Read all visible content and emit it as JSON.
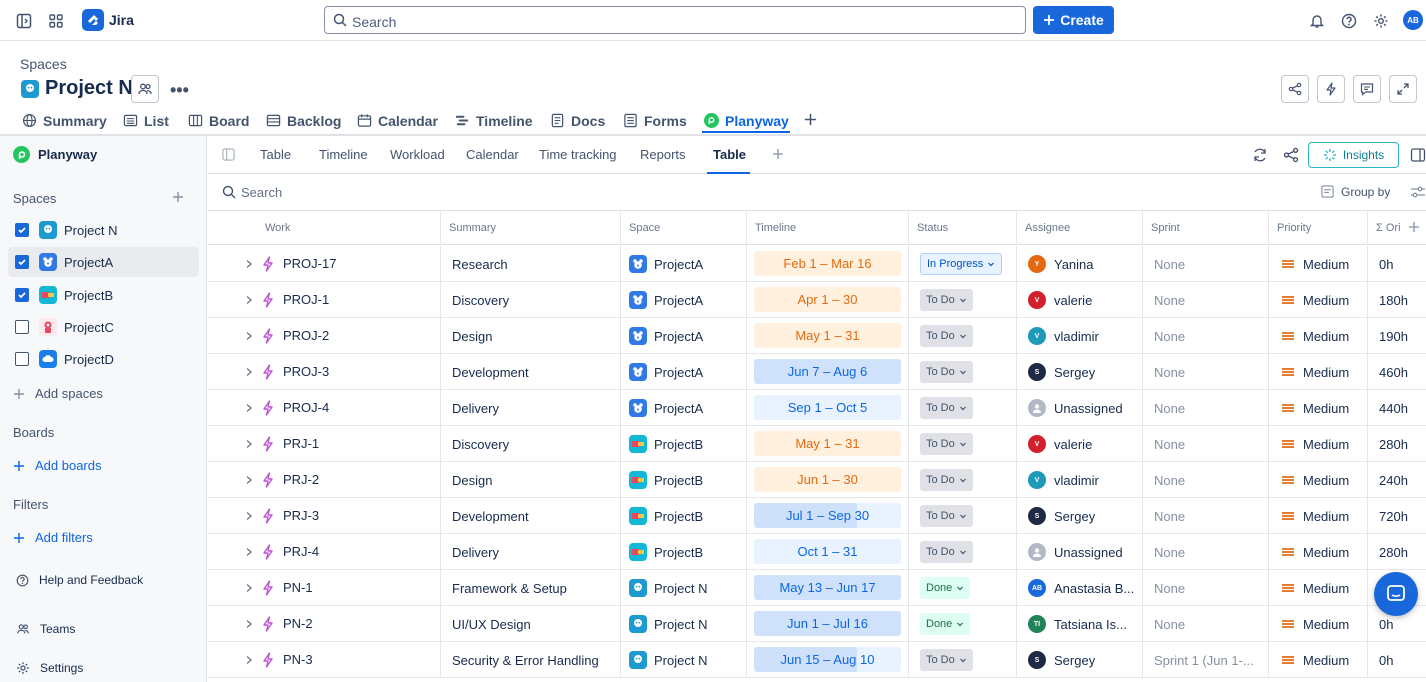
{
  "topbar": {
    "app_name": "Jira",
    "search_placeholder": "Search",
    "create_label": "Create",
    "avatar_initials": "AB"
  },
  "project": {
    "breadcrumb": "Spaces",
    "title": "Project N"
  },
  "project_tabs": [
    {
      "label": "Summary",
      "icon": "globe-icon"
    },
    {
      "label": "List",
      "icon": "list-icon"
    },
    {
      "label": "Board",
      "icon": "board-icon"
    },
    {
      "label": "Backlog",
      "icon": "backlog-icon"
    },
    {
      "label": "Calendar",
      "icon": "calendar-icon"
    },
    {
      "label": "Timeline",
      "icon": "timeline-icon"
    },
    {
      "label": "Docs",
      "icon": "docs-icon"
    },
    {
      "label": "Forms",
      "icon": "forms-icon"
    },
    {
      "label": "Planyway",
      "icon": "planyway-icon",
      "active": true
    }
  ],
  "sidebar": {
    "app_title": "Planyway",
    "spaces_heading": "Spaces",
    "spaces": [
      {
        "name": "Project N",
        "checked": true,
        "color": "#1d9bd1"
      },
      {
        "name": "ProjectA",
        "checked": true,
        "color": "#2f7ae5",
        "selected": true
      },
      {
        "name": "ProjectB",
        "checked": true,
        "color": "#12b8d6"
      },
      {
        "name": "ProjectC",
        "checked": false,
        "color": "#e8475f"
      },
      {
        "name": "ProjectD",
        "checked": false,
        "color": "#1a7fe8"
      }
    ],
    "add_spaces": "Add spaces",
    "boards_heading": "Boards",
    "add_boards": "Add boards",
    "filters_heading": "Filters",
    "add_filters": "Add filters",
    "help": "Help and Feedback",
    "teams": "Teams",
    "settings": "Settings"
  },
  "subtabs": [
    "Table",
    "Timeline",
    "Workload",
    "Calendar",
    "Time tracking",
    "Reports",
    "Table"
  ],
  "active_subtab": "Table",
  "insights_label": "Insights",
  "filter": {
    "search_placeholder": "Search",
    "group_by": "Group by"
  },
  "columns": [
    "Work",
    "Summary",
    "Space",
    "Timeline",
    "Status",
    "Assignee",
    "Sprint",
    "Priority",
    "Σ Ori"
  ],
  "rows": [
    {
      "key": "PROJ-17",
      "summary": "Research",
      "space": "ProjectA",
      "timeline": "Feb 1 – Mar 16",
      "tl_style": "orange",
      "status": "In Progress",
      "status_style": "prog",
      "assignee": "Yanina",
      "av_initial": "Y",
      "av_color": "#e56910",
      "sprint": "None",
      "priority": "Medium",
      "orig": "0h"
    },
    {
      "key": "PROJ-1",
      "summary": "Discovery",
      "space": "ProjectA",
      "timeline": "Apr 1 – 30",
      "tl_style": "orange",
      "status": "To Do",
      "status_style": "todo",
      "assignee": "valerie",
      "av_initial": "V",
      "av_color": "#d1202c",
      "sprint": "None",
      "priority": "Medium",
      "orig": "180h"
    },
    {
      "key": "PROJ-2",
      "summary": "Design",
      "space": "ProjectA",
      "timeline": "May 1 – 31",
      "tl_style": "orange",
      "status": "To Do",
      "status_style": "todo",
      "assignee": "vladimir",
      "av_initial": "V",
      "av_color": "#1d9ab8",
      "sprint": "None",
      "priority": "Medium",
      "orig": "190h"
    },
    {
      "key": "PROJ-3",
      "summary": "Development",
      "space": "ProjectA",
      "timeline": "Jun 7 – Aug 6",
      "tl_style": "blueS",
      "status": "To Do",
      "status_style": "todo",
      "assignee": "Sergey",
      "av_initial": "S",
      "av_color": "#1f2a44",
      "sprint": "None",
      "priority": "Medium",
      "orig": "460h"
    },
    {
      "key": "PROJ-4",
      "summary": "Delivery",
      "space": "ProjectA",
      "timeline": "Sep 1 – Oct 5",
      "tl_style": "blue",
      "status": "To Do",
      "status_style": "todo",
      "assignee": "Unassigned",
      "av_initial": "",
      "av_color": "#b3b9c4",
      "sprint": "None",
      "priority": "Medium",
      "orig": "440h"
    },
    {
      "key": "PRJ-1",
      "summary": "Discovery",
      "space": "ProjectB",
      "timeline": "May 1 – 31",
      "tl_style": "orange",
      "status": "To Do",
      "status_style": "todo",
      "assignee": "valerie",
      "av_initial": "V",
      "av_color": "#d1202c",
      "sprint": "None",
      "priority": "Medium",
      "orig": "280h"
    },
    {
      "key": "PRJ-2",
      "summary": "Design",
      "space": "ProjectB",
      "timeline": "Jun 1 – 30",
      "tl_style": "orange",
      "status": "To Do",
      "status_style": "todo",
      "assignee": "vladimir",
      "av_initial": "V",
      "av_color": "#1d9ab8",
      "sprint": "None",
      "priority": "Medium",
      "orig": "240h"
    },
    {
      "key": "PRJ-3",
      "summary": "Development",
      "space": "ProjectB",
      "timeline": "Jul 1 – Sep 30",
      "tl_style": "prog",
      "status": "To Do",
      "status_style": "todo",
      "assignee": "Sergey",
      "av_initial": "S",
      "av_color": "#1f2a44",
      "sprint": "None",
      "priority": "Medium",
      "orig": "720h"
    },
    {
      "key": "PRJ-4",
      "summary": "Delivery",
      "space": "ProjectB",
      "timeline": "Oct 1 – 31",
      "tl_style": "blue",
      "status": "To Do",
      "status_style": "todo",
      "assignee": "Unassigned",
      "av_initial": "",
      "av_color": "#b3b9c4",
      "sprint": "None",
      "priority": "Medium",
      "orig": "280h"
    },
    {
      "key": "PN-1",
      "summary": "Framework & Setup",
      "space": "Project N",
      "timeline": "May 13 – Jun 17",
      "tl_style": "blueS",
      "status": "Done",
      "status_style": "done",
      "assignee": "Anastasia B...",
      "av_initial": "AB",
      "av_color": "#1868db",
      "sprint": "None",
      "priority": "Medium",
      "orig": ""
    },
    {
      "key": "PN-2",
      "summary": "UI/UX Design",
      "space": "Project N",
      "timeline": "Jun 1 – Jul 16",
      "tl_style": "blueS",
      "status": "Done",
      "status_style": "done",
      "assignee": "Tatsiana Is...",
      "av_initial": "TI",
      "av_color": "#1f845a",
      "sprint": "None",
      "priority": "Medium",
      "orig": "0h"
    },
    {
      "key": "PN-3",
      "summary": "Security & Error Handling",
      "space": "Project N",
      "timeline": "Jun 15 – Aug 10",
      "tl_style": "prog",
      "status": "To Do",
      "status_style": "todo",
      "assignee": "Sergey",
      "av_initial": "S",
      "av_color": "#1f2a44",
      "sprint": "Sprint 1 (Jun 1-...",
      "priority": "Medium",
      "orig": "0h"
    }
  ],
  "colors": {
    "accent": "#1868db",
    "priority_medium": "#e56910",
    "insights": "#2bb3c7"
  }
}
